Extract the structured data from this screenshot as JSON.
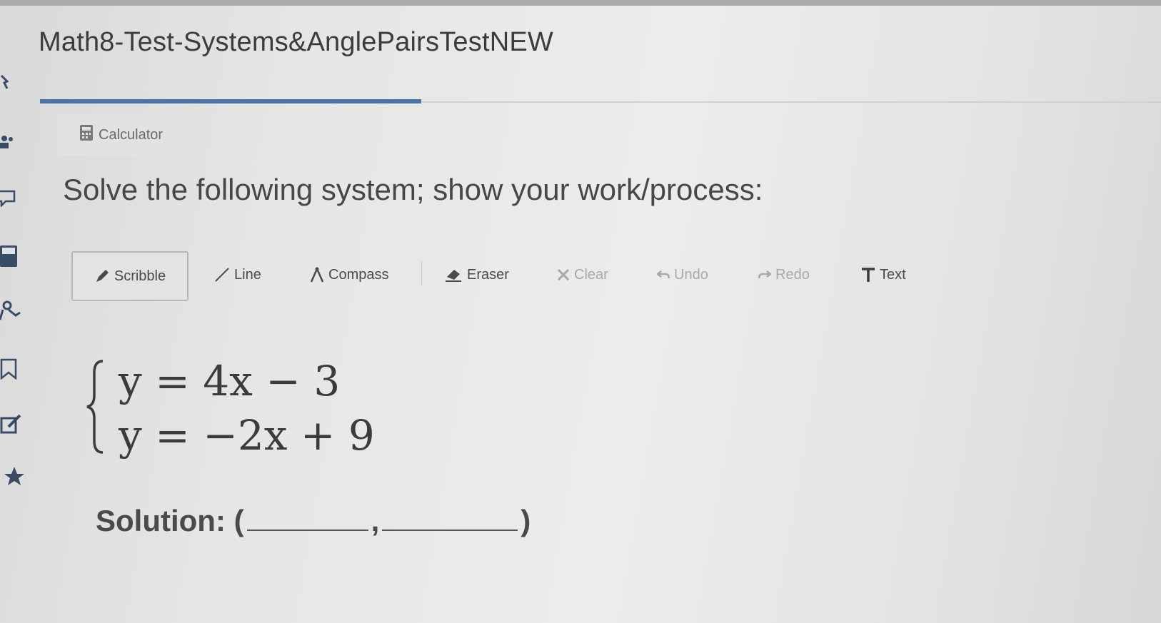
{
  "title": "Math8-Test-Systems&AnglePairsTestNEW",
  "progress": {
    "fraction": 0.34
  },
  "calculator": {
    "label": "Calculator",
    "icon": "calculator-icon"
  },
  "prompt": "Solve the following system; show your work/process:",
  "toolbar": {
    "tools": [
      {
        "label": "Scribble",
        "icon": "pencil-icon",
        "active": true,
        "enabled": true
      },
      {
        "label": "Line",
        "icon": "line-icon",
        "active": false,
        "enabled": true
      },
      {
        "label": "Compass",
        "icon": "compass-icon",
        "active": false,
        "enabled": true
      },
      {
        "label": "Eraser",
        "icon": "eraser-icon",
        "active": false,
        "enabled": true
      },
      {
        "label": "Clear",
        "icon": "x-icon",
        "active": false,
        "enabled": false
      },
      {
        "label": "Undo",
        "icon": "undo-icon",
        "active": false,
        "enabled": false
      },
      {
        "label": "Redo",
        "icon": "redo-icon",
        "active": false,
        "enabled": false
      },
      {
        "label": "Text",
        "icon": "text-icon",
        "active": false,
        "enabled": true
      }
    ]
  },
  "system": {
    "eq1": "y = 4x − 3",
    "eq2": "y = −2x + 9"
  },
  "solution": {
    "label": "Solution: (",
    "separator": ",",
    "close": ")"
  },
  "colors": {
    "accent": "#4a74a8",
    "sidebar_icon": "#3a4b66",
    "text": "#474747"
  }
}
